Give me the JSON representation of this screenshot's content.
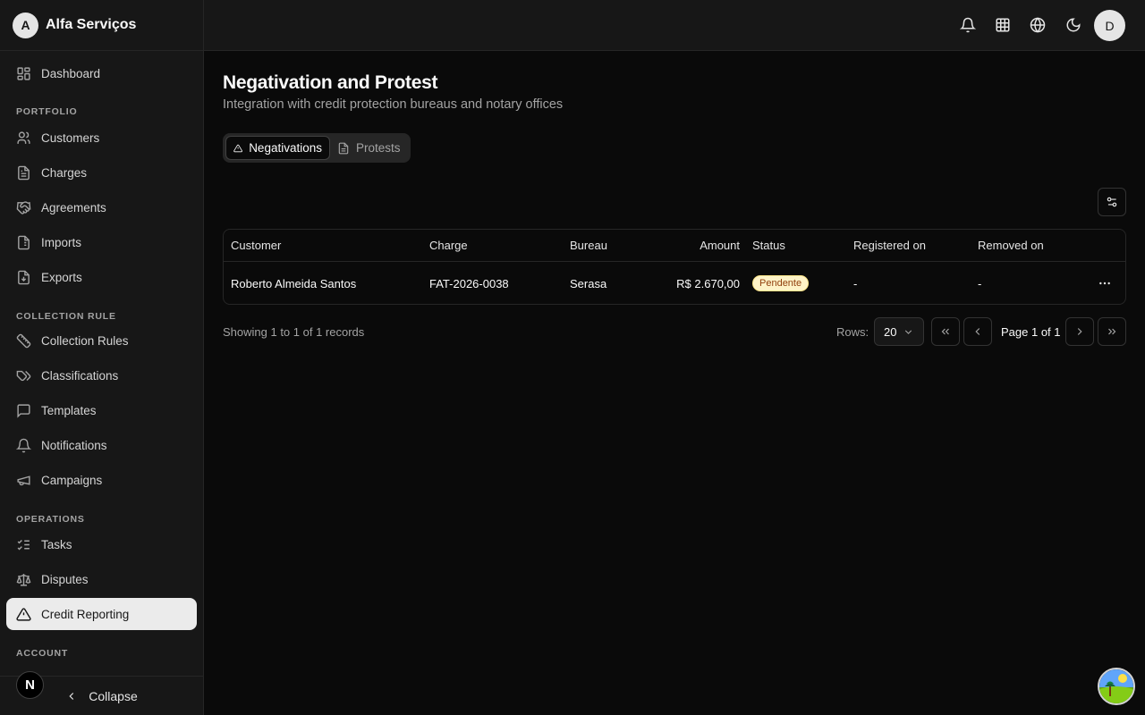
{
  "brand": {
    "initial": "A",
    "name": "Alfa Serviços"
  },
  "sidebar": {
    "dashboard": "Dashboard",
    "sections": {
      "portfolio": "PORTFOLIO",
      "collection_rule": "COLLECTION RULE",
      "operations": "OPERATIONS",
      "account": "ACCOUNT"
    },
    "items": {
      "customers": "Customers",
      "charges": "Charges",
      "agreements": "Agreements",
      "imports": "Imports",
      "exports": "Exports",
      "collection_rules": "Collection Rules",
      "classifications": "Classifications",
      "templates": "Templates",
      "notifications": "Notifications",
      "campaigns": "Campaigns",
      "tasks": "Tasks",
      "disputes": "Disputes",
      "credit_reporting": "Credit Reporting"
    },
    "collapse": "Collapse",
    "n_badge": "N"
  },
  "header": {
    "user_initial": "D"
  },
  "page": {
    "title": "Negativation and Protest",
    "subtitle": "Integration with credit protection bureaus and notary offices"
  },
  "tabs": [
    {
      "label": "Negativations",
      "active": true
    },
    {
      "label": "Protests",
      "active": false
    }
  ],
  "table": {
    "columns": [
      "Customer",
      "Charge",
      "Bureau",
      "Amount",
      "Status",
      "Registered on",
      "Removed on"
    ],
    "rows": [
      {
        "customer": "Roberto Almeida Santos",
        "charge": "FAT-2026-0038",
        "bureau": "Serasa",
        "amount": "R$ 2.670,00",
        "status": "Pendente",
        "registered_on": "-",
        "removed_on": "-"
      }
    ]
  },
  "pagination": {
    "showing": "Showing 1 to 1 of 1 records",
    "rows_label": "Rows:",
    "rows_value": "20",
    "page_info": "Page 1 of 1"
  },
  "colors": {
    "status_pending_bg": "#fef3c7",
    "status_pending_text": "#92400e",
    "active_nav_bg": "#ebebeb"
  }
}
